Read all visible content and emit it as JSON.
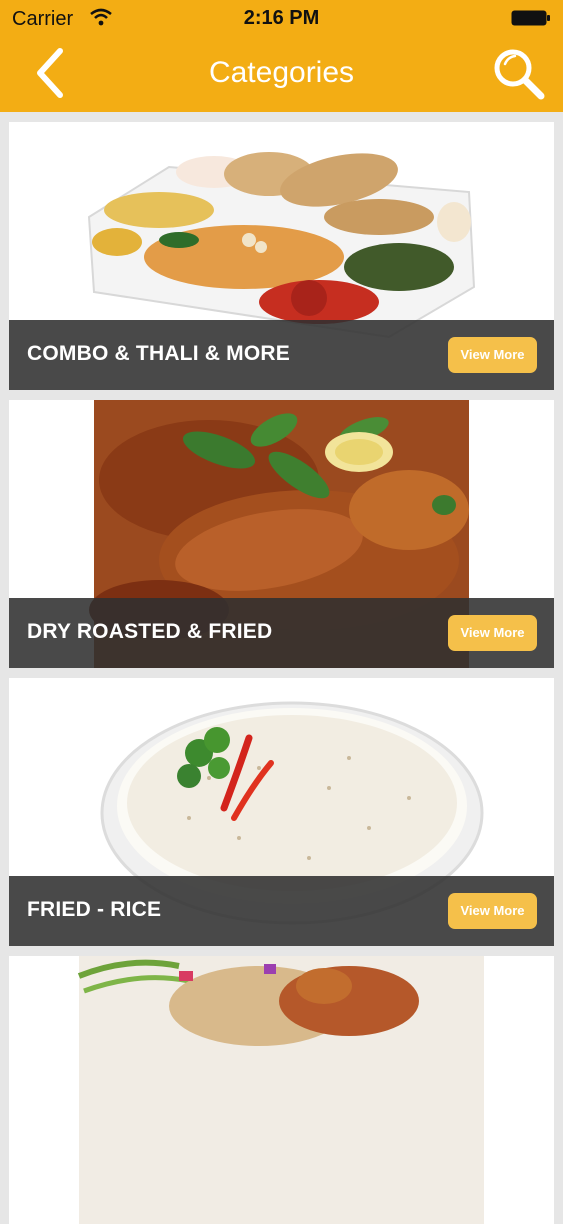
{
  "status_bar": {
    "carrier": "Carrier",
    "time": "2:16 PM",
    "icons": [
      "wifi-icon",
      "battery-icon"
    ]
  },
  "nav": {
    "title": "Categories",
    "back_icon": "chevron-left-icon",
    "search_icon": "search-icon"
  },
  "colors": {
    "brand": "#f3ad14",
    "button": "#f5c04a",
    "overlay": "#303030",
    "background": "#e6e6e6"
  },
  "categories": [
    {
      "name": "COMBO & THALI & MORE",
      "button": "View More",
      "image": "thali-plate-image"
    },
    {
      "name": "DRY ROASTED & FRIED",
      "button": "View More",
      "image": "roasted-chicken-image"
    },
    {
      "name": "FRIED - RICE",
      "button": "View More",
      "image": "rice-bowl-image"
    },
    {
      "name": "",
      "button": "",
      "image": "curry-dish-image"
    }
  ]
}
